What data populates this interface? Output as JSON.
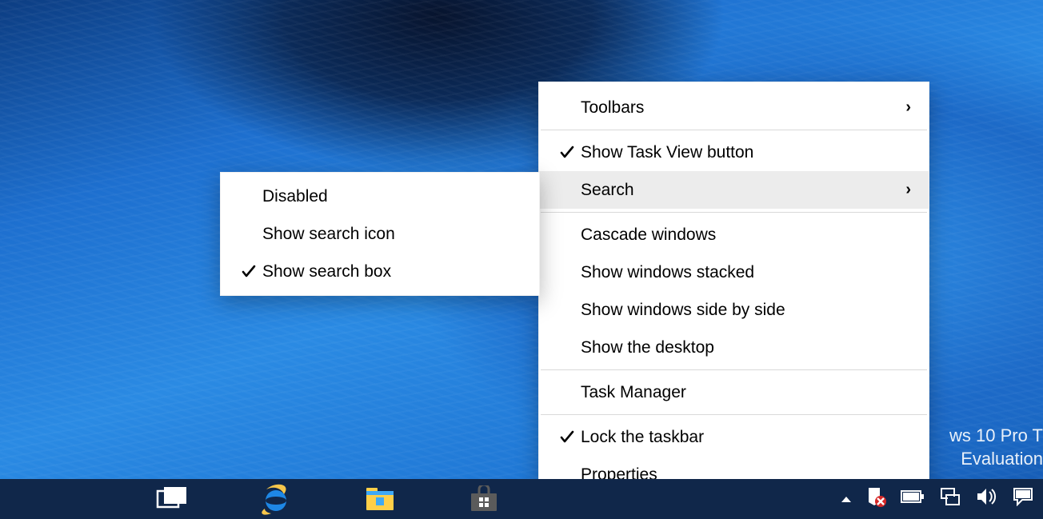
{
  "watermark": {
    "line1": "ws 10 Pro T",
    "line2": "Evaluation"
  },
  "context_menu": {
    "toolbars": "Toolbars",
    "show_task_view": "Show Task View button",
    "search": "Search",
    "cascade": "Cascade windows",
    "stacked": "Show windows stacked",
    "side_by_side": "Show windows side by side",
    "show_desktop": "Show the desktop",
    "task_manager": "Task Manager",
    "lock_taskbar": "Lock the taskbar",
    "properties": "Properties",
    "checked": {
      "show_task_view": true,
      "lock_taskbar": true
    }
  },
  "search_submenu": {
    "disabled": "Disabled",
    "show_icon": "Show search icon",
    "show_box": "Show search box",
    "checked": "show_box"
  },
  "taskbar": {
    "items": [
      "task-view",
      "internet-explorer",
      "file-explorer",
      "store"
    ]
  },
  "tray": {
    "items": [
      "overflow",
      "security-alert",
      "battery",
      "network",
      "volume",
      "action-center"
    ]
  }
}
